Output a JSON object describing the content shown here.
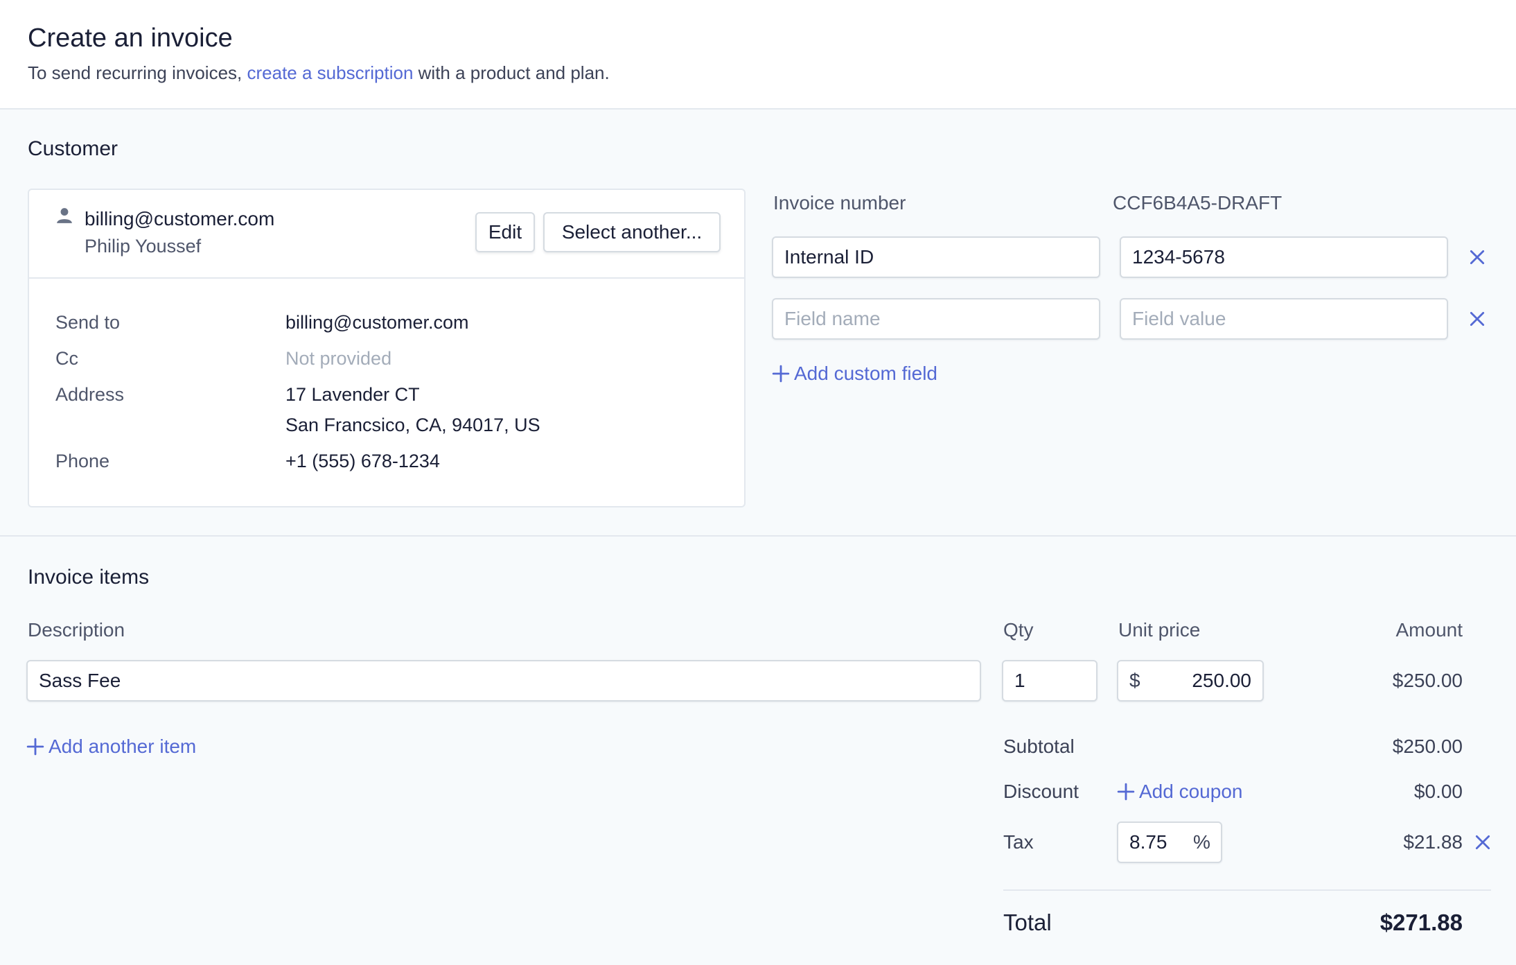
{
  "header": {
    "title": "Create an invoice",
    "subtitle_before": "To send recurring invoices,",
    "subtitle_link": "create a subscription",
    "subtitle_after": "with a product and plan."
  },
  "customer": {
    "section_title": "Customer",
    "email": "billing@customer.com",
    "name": "Philip Youssef",
    "edit_label": "Edit",
    "select_another_label": "Select another...",
    "person_icon": "person-icon",
    "details": {
      "send_to_label": "Send to",
      "send_to_value": "billing@customer.com",
      "cc_label": "Cc",
      "cc_value": "Not provided",
      "address_label": "Address",
      "address_line1": "17 Lavender CT",
      "address_line2": "San Francsico, CA, 94017, US",
      "phone_label": "Phone",
      "phone_value": "+1 (555) 678-1234"
    }
  },
  "invoice_meta": {
    "number_label": "Invoice number",
    "number_value": "CCF6B4A5-DRAFT",
    "custom_fields": [
      {
        "name": "Internal ID",
        "value": "1234-5678",
        "name_placeholder": "Field name",
        "value_placeholder": "Field value"
      },
      {
        "name": "",
        "value": "",
        "name_placeholder": "Field name",
        "value_placeholder": "Field value"
      }
    ],
    "add_custom_field_label": "Add custom field"
  },
  "items": {
    "section_title": "Invoice items",
    "columns": {
      "description": "Description",
      "qty": "Qty",
      "unit_price": "Unit price",
      "amount": "Amount"
    },
    "rows": [
      {
        "description": "Sass Fee",
        "qty": "1",
        "currency": "$",
        "unit_price": "250.00",
        "amount": "$250.00"
      }
    ],
    "add_item_label": "Add another item"
  },
  "summary": {
    "subtotal_label": "Subtotal",
    "subtotal_value": "$250.00",
    "discount_label": "Discount",
    "add_coupon_label": "Add coupon",
    "discount_value": "$0.00",
    "tax_label": "Tax",
    "tax_rate": "8.75",
    "tax_unit": "%",
    "tax_value": "$21.88",
    "total_label": "Total",
    "total_value": "$271.88"
  },
  "colors": {
    "accent": "#5469d4",
    "text_primary": "#1a1f36",
    "text_secondary": "#4f566b",
    "placeholder": "#a3acb9",
    "border": "#e3e8ee",
    "background": "#f7fafc"
  }
}
